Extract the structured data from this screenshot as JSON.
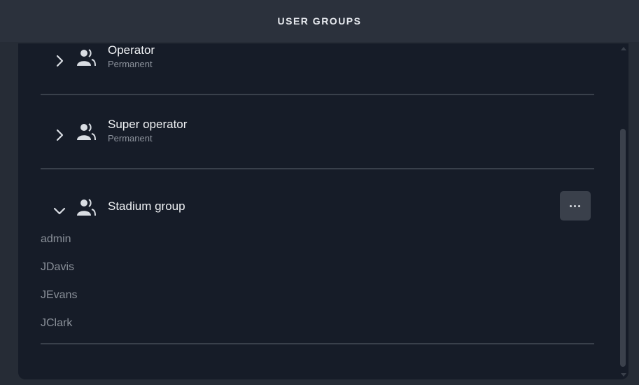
{
  "header": {
    "title": "USER GROUPS"
  },
  "groups": [
    {
      "name": "Operator",
      "subtitle": "Permanent",
      "expanded": false
    },
    {
      "name": "Super operator",
      "subtitle": "Permanent",
      "expanded": false
    },
    {
      "name": "Stadium group",
      "subtitle": "",
      "expanded": true,
      "members": [
        "admin",
        "JDavis",
        "JEvans",
        "JClark"
      ]
    }
  ],
  "icons": {
    "collapsed": "chevron-right-icon",
    "expanded": "chevron-down-icon",
    "group": "users-icon",
    "more": "more-horizontal-icon"
  },
  "colors": {
    "background": "#262c36",
    "panel": "#161c28",
    "divider": "#39404b",
    "text": "#f0f2f5",
    "muted": "#8a9099"
  }
}
